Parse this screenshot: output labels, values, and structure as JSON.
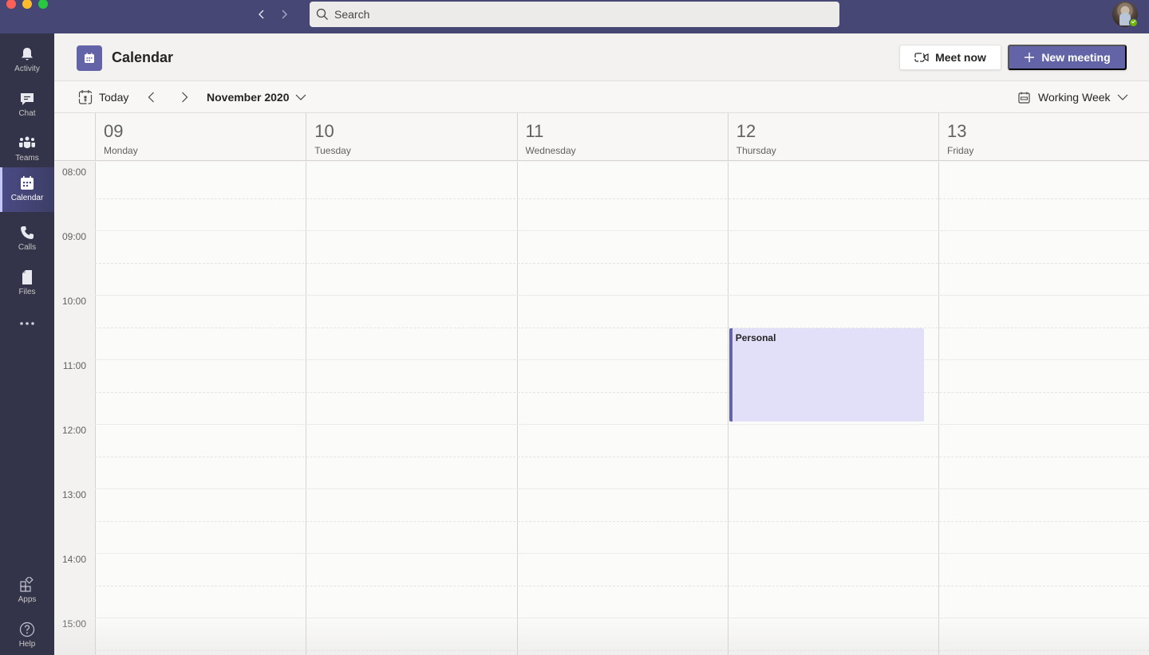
{
  "titlebar": {
    "search_placeholder": "Search",
    "back_icon": "chevron-left-icon",
    "forward_icon": "chevron-right-icon",
    "presence_status": "available",
    "colors": {
      "bar": "#464775",
      "search_bg": "#edebe9",
      "presence": "#6bb700"
    }
  },
  "rail": {
    "items": [
      {
        "label": "Activity",
        "icon": "bell-icon",
        "active": false
      },
      {
        "label": "Chat",
        "icon": "chat-icon",
        "active": false
      },
      {
        "label": "Teams",
        "icon": "teams-icon",
        "active": false
      },
      {
        "label": "Calendar",
        "icon": "calendar-icon",
        "active": true
      },
      {
        "label": "Calls",
        "icon": "phone-icon",
        "active": false
      },
      {
        "label": "Files",
        "icon": "file-icon",
        "active": false
      }
    ],
    "more_icon": "more-horizontal-icon",
    "bottom_items": [
      {
        "label": "Apps",
        "icon": "apps-icon"
      },
      {
        "label": "Help",
        "icon": "help-icon"
      }
    ],
    "colors": {
      "bg": "#33344a",
      "active_indicator": "#c5c7f7"
    }
  },
  "header": {
    "title": "Calendar",
    "meet_now_label": "Meet now",
    "new_meeting_label": "New meeting",
    "colors": {
      "brand": "#6264a7"
    }
  },
  "toolbar": {
    "today_label": "Today",
    "month_label": "November 2020",
    "view_label": "Working Week"
  },
  "days": [
    {
      "num": "09",
      "name": "Monday"
    },
    {
      "num": "10",
      "name": "Tuesday"
    },
    {
      "num": "11",
      "name": "Wednesday"
    },
    {
      "num": "12",
      "name": "Thursday"
    },
    {
      "num": "13",
      "name": "Friday"
    }
  ],
  "times": [
    "08:00",
    "09:00",
    "10:00",
    "11:00",
    "12:00",
    "13:00",
    "14:00",
    "15:00"
  ],
  "events": [
    {
      "title": "Personal",
      "day_index": 3,
      "start": "10:30",
      "end": "12:00",
      "color": "#6264a7",
      "bg": "#e2e0f8"
    }
  ]
}
